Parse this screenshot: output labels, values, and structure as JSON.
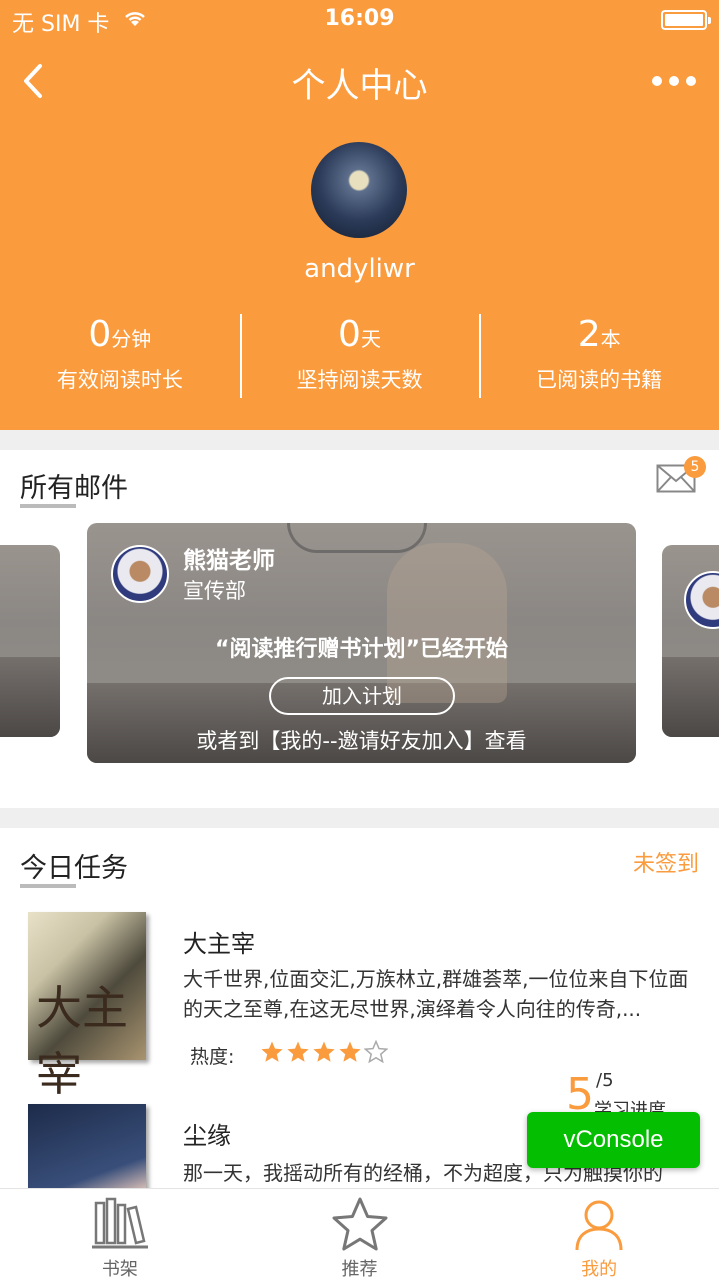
{
  "status_bar": {
    "carrier": "无 SIM 卡",
    "time": "16:09"
  },
  "nav": {
    "title": "个人中心",
    "back_icon": "back-arrow-icon",
    "more_icon": "more-dots-icon"
  },
  "profile": {
    "username": "andyliwr"
  },
  "stats": [
    {
      "value": "0",
      "unit": "分钟",
      "label": "有效阅读时长"
    },
    {
      "value": "0",
      "unit": "天",
      "label": "坚持阅读天数"
    },
    {
      "value": "2",
      "unit": "本",
      "label": "已阅读的书籍"
    }
  ],
  "mail": {
    "title": "所有邮件",
    "badge": "5",
    "card": {
      "sender": "熊猫老师",
      "dept": "宣传部",
      "message": "“阅读推行赠书计划”已经开始",
      "join_label": "加入计划",
      "hint": "或者到【我的--邀请好友加入】查看"
    }
  },
  "tasks": {
    "title": "今日任务",
    "signin": "未签到",
    "hot_label": "热度:",
    "books": [
      {
        "title": "大主宰",
        "desc": "大千世界,位面交汇,万族林立,群雄荟萃,一位位来自下位面的天之至尊,在这无尽世界,演绎着令人向往的传奇,...",
        "cover_text": "大主宰",
        "rating": 4,
        "rating_max": 5
      },
      {
        "title": "尘缘",
        "desc": "那一天，我摇动所有的经桶，不为超度，只为触摸你的"
      }
    ],
    "progress": {
      "value": "5",
      "denominator": "/5",
      "label": "学习进度"
    }
  },
  "vconsole": {
    "label": "vConsole"
  },
  "tabbar": [
    {
      "label": "书架",
      "icon": "bookshelf-icon",
      "active": false
    },
    {
      "label": "推荐",
      "icon": "star-icon",
      "active": false
    },
    {
      "label": "我的",
      "icon": "person-icon",
      "active": true
    }
  ],
  "colors": {
    "accent": "#fa9b3e",
    "vconsole": "#04be02"
  }
}
